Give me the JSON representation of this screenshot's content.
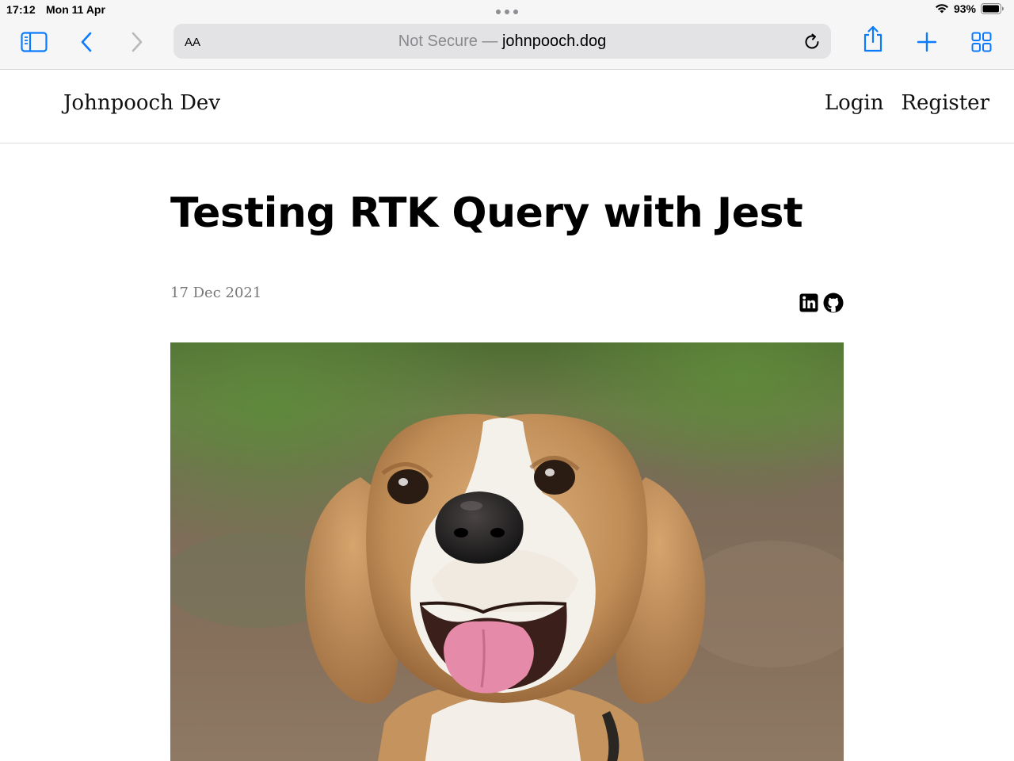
{
  "status_bar": {
    "time": "17:12",
    "date": "Mon 11 Apr",
    "battery": "93%"
  },
  "browser": {
    "aa_label": "AA",
    "address_prefix": "Not Secure — ",
    "address_host": "johnpooch.dog",
    "accent_color": "#0a7aff"
  },
  "site": {
    "brand": "Johnpooch Dev",
    "nav": {
      "login": "Login",
      "register": "Register"
    }
  },
  "article": {
    "title": "Testing RTK Query with Jest",
    "date": "17 Dec 2021",
    "social_icons": [
      "linkedin-icon",
      "github-icon"
    ]
  }
}
